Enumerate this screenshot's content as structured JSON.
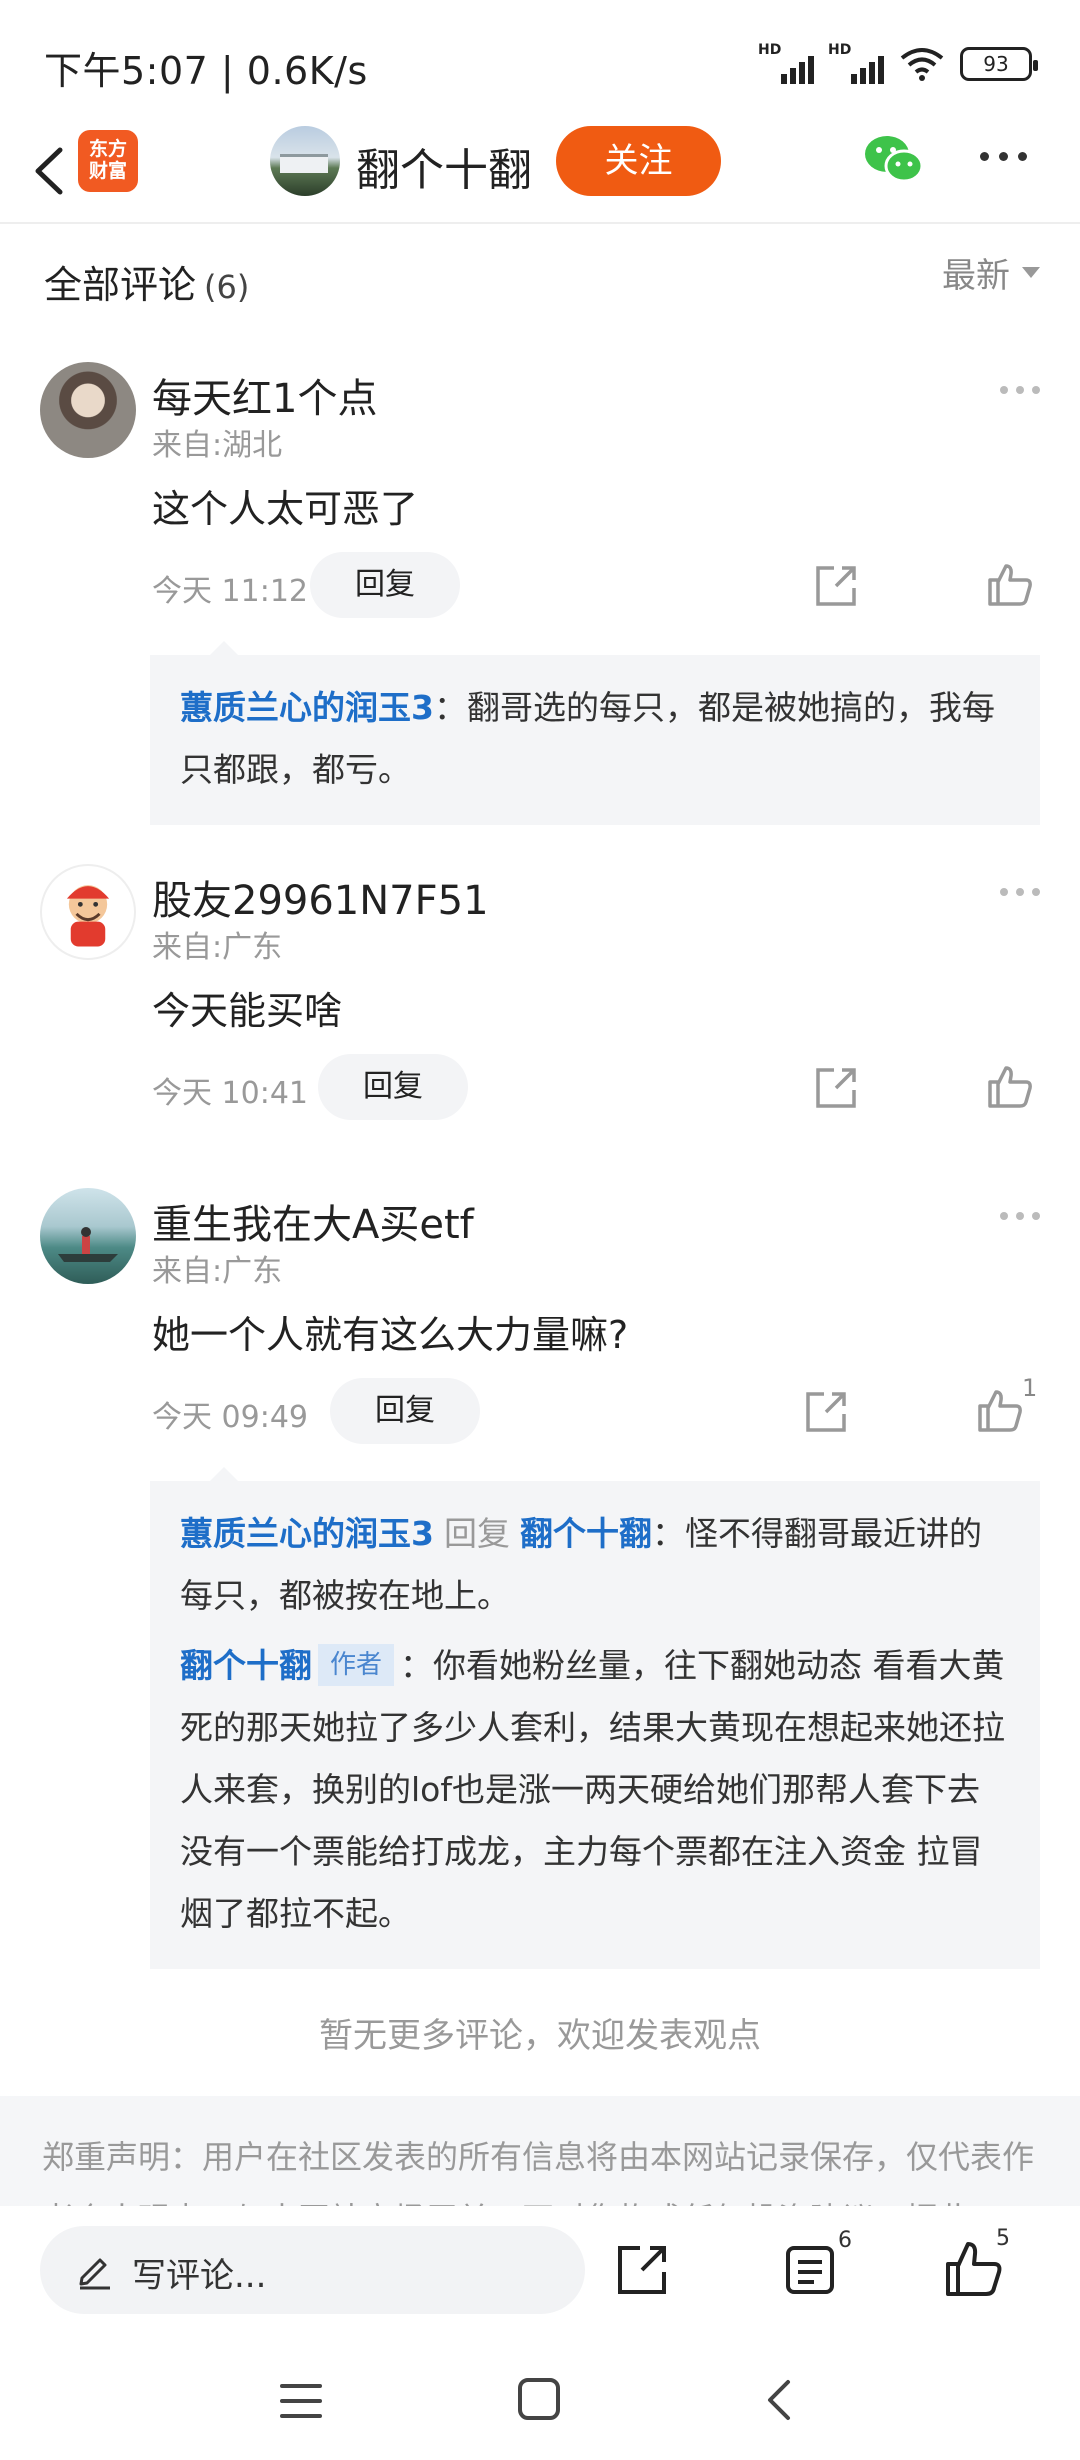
{
  "status_bar": {
    "time_speed": "下午5:07 | 0.6K/s",
    "battery": "93",
    "hd_label": "HD"
  },
  "nav": {
    "logo_line1": "东方",
    "logo_line2": "财富",
    "author": "翻个十翻",
    "follow_label": "关注"
  },
  "comments_header": {
    "title": "全部评论",
    "count": "(6)",
    "sort_label": "最新"
  },
  "comments": [
    {
      "name": "每天红1个点",
      "location": "来自:湖北",
      "text": "这个人太可恶了",
      "time": "今天 11:12",
      "reply_label": "回复",
      "like_count": "",
      "replies": [
        {
          "user": "蕙质兰心的润玉3",
          "text": "：翻哥选的每只，都是被她搞的，我每只都跟，都亏。"
        }
      ]
    },
    {
      "name": "股友29961N7F51",
      "location": "来自:广东",
      "text": "今天能买啥",
      "time": "今天 10:41",
      "reply_label": "回复",
      "like_count": ""
    },
    {
      "name": "重生我在大A买etf",
      "location": "来自:广东",
      "text": "她一个人就有这么大力量嘛?",
      "time": "今天 09:49",
      "reply_label": "回复",
      "like_count": "1",
      "replies": [
        {
          "user": "蕙质兰心的润玉3",
          "reply_word": "回复",
          "target": "翻个十翻",
          "text": "：怪不得翻哥最近讲的每只，都被按在地上。"
        },
        {
          "user": "翻个十翻",
          "badge": "作者",
          "text": "：你看她粉丝量，往下翻她动态 看看大黄死的那天她拉了多少人套利，结果大黄现在想起来她还拉人来套，换别的lof也是涨一两天硬给她们那帮人套下去没有一个票能给打成龙，主力每个票都在注入资金 拉冒烟了都拉不起。"
        }
      ]
    }
  ],
  "no_more": "暂无更多评论，欢迎发表观点",
  "disclaimer": "郑重声明：用户在社区发表的所有信息将由本网站记录保存，仅代表作者个人观点，与本网站立场无关，不对您构成任何投资建议，据此",
  "bottom_bar": {
    "input_placeholder": "写评论...",
    "comment_count": "6",
    "like_count": "5"
  },
  "icons": {
    "accent": "#f05b12",
    "link_blue": "#1e6ec8",
    "wechat_green": "#3ec34a"
  }
}
